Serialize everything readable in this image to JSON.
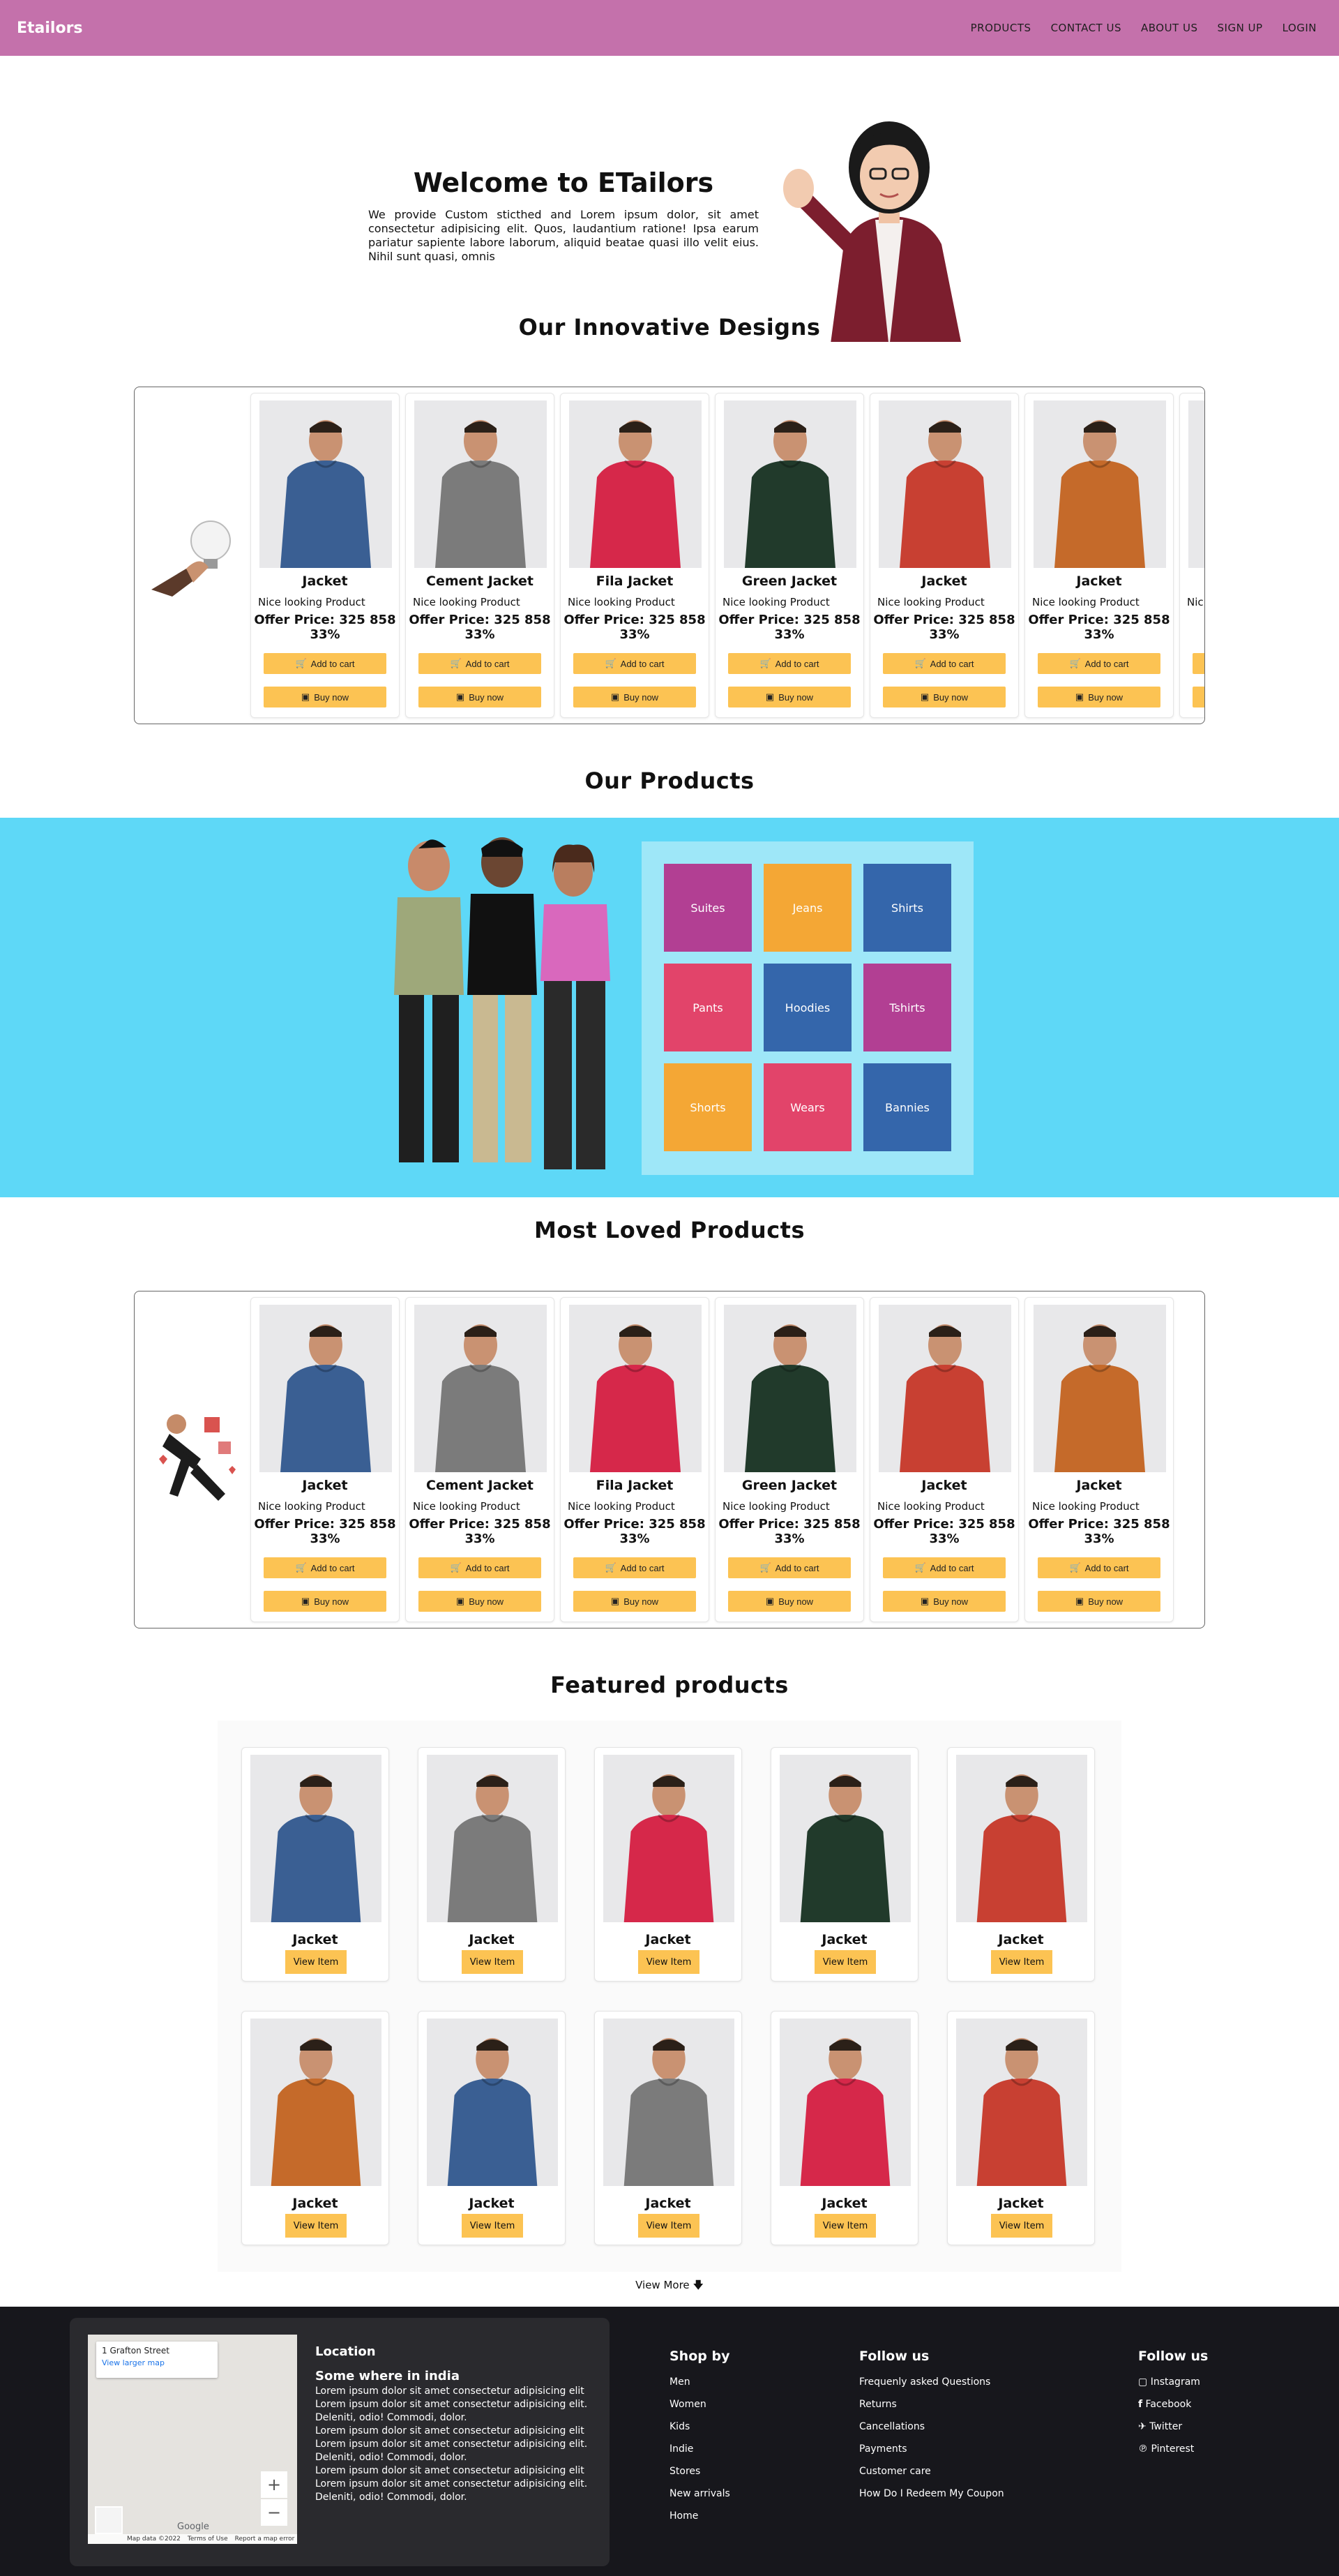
{
  "nav": {
    "brand": "Etailors",
    "links": [
      "PRODUCTS",
      "CONTACT US",
      "ABOUT US",
      "SIGN UP",
      "LOGIN"
    ]
  },
  "hero": {
    "title": "Welcome to ETailors",
    "description": "We provide Custom sticthed and Lorem ipsum dolor, sit amet consectetur adipisicing elit. Quos, laudantium ratione! Ipsa earum pariatur sapiente labore laborum, aliquid beatae quasi illo velit eius. Nihil sunt quasi, omnis"
  },
  "sections": {
    "innovative": "Our Innovative Designs",
    "products": "Our Products",
    "loved": "Most Loved Products",
    "featured": "Featured products"
  },
  "buttons": {
    "add_to_cart": "Add to cart",
    "buy_now": "Buy now",
    "view_item": "View Item",
    "view_more": "View More"
  },
  "innovative_products": [
    {
      "name": "Jacket",
      "sub": "Nice looking Product",
      "price": "Offer Price: 325 858 33%",
      "color": "#3a5f93"
    },
    {
      "name": "Cement Jacket",
      "sub": "Nice looking Product",
      "price": "Offer Price: 325 858 33%",
      "color": "#7b7b7b"
    },
    {
      "name": "Fila Jacket",
      "sub": "Nice looking Product",
      "price": "Offer Price: 325 858 33%",
      "color": "#d6284a"
    },
    {
      "name": "Green Jacket",
      "sub": "Nice looking Product",
      "price": "Offer Price: 325 858 33%",
      "color": "#213a2b"
    },
    {
      "name": "Jacket",
      "sub": "Nice looking Product",
      "price": "Offer Price: 325 858 33%",
      "color": "#c84032"
    },
    {
      "name": "Jacket",
      "sub": "Nice looking Product",
      "price": "Offer Price: 325 858 33%",
      "color": "#c56a2a"
    },
    {
      "name": "Jac",
      "sub": "Nic",
      "price": "Of",
      "color": "#888888"
    }
  ],
  "loved_products": [
    {
      "name": "Jacket",
      "sub": "Nice looking Product",
      "price": "Offer Price: 325 858 33%",
      "color": "#3a5f93"
    },
    {
      "name": "Cement Jacket",
      "sub": "Nice looking Product",
      "price": "Offer Price: 325 858 33%",
      "color": "#7b7b7b"
    },
    {
      "name": "Fila Jacket",
      "sub": "Nice looking Product",
      "price": "Offer Price: 325 858 33%",
      "color": "#d6284a"
    },
    {
      "name": "Green Jacket",
      "sub": "Nice looking Product",
      "price": "Offer Price: 325 858 33%",
      "color": "#213a2b"
    },
    {
      "name": "Jacket",
      "sub": "Nice looking Product",
      "price": "Offer Price: 325 858 33%",
      "color": "#c84032"
    },
    {
      "name": "Jacket",
      "sub": "Nice looking Product",
      "price": "Offer Price: 325 858 33%",
      "color": "#c56a2a"
    }
  ],
  "categories": [
    {
      "label": "Suites",
      "color": "#b23f93"
    },
    {
      "label": "Jeans",
      "color": "#f4a735"
    },
    {
      "label": "Shirts",
      "color": "#3466ab"
    },
    {
      "label": "Pants",
      "color": "#e2446a"
    },
    {
      "label": "Hoodies",
      "color": "#3466ab"
    },
    {
      "label": "Tshirts",
      "color": "#b23f93"
    },
    {
      "label": "Shorts",
      "color": "#f4a735"
    },
    {
      "label": "Wears",
      "color": "#e2446a"
    },
    {
      "label": "Bannies",
      "color": "#3466ab"
    }
  ],
  "featured_products": [
    {
      "name": "Jacket",
      "color": "#3a5f93"
    },
    {
      "name": "Jacket",
      "color": "#7b7b7b"
    },
    {
      "name": "Jacket",
      "color": "#d6284a"
    },
    {
      "name": "Jacket",
      "color": "#213a2b"
    },
    {
      "name": "Jacket",
      "color": "#c84032"
    },
    {
      "name": "Jacket",
      "color": "#c56a2a"
    },
    {
      "name": "Jacket",
      "color": "#3a5f93"
    },
    {
      "name": "Jacket",
      "color": "#7b7b7b"
    },
    {
      "name": "Jacket",
      "color": "#d6284a"
    },
    {
      "name": "Jacket",
      "color": "#c84032"
    }
  ],
  "footer": {
    "map": {
      "address": "1 Grafton Street",
      "link": "View larger map",
      "zoom_in": "+",
      "zoom_out": "−",
      "google": "Google",
      "attrib": [
        "Map data ©2022",
        "Terms of Use",
        "Report a map error"
      ]
    },
    "location": {
      "heading": "Location",
      "subheading": "Some where in india",
      "paragraphs": [
        "Lorem ipsum dolor sit amet consectetur adipisicing elit Lorem ipsum dolor sit amet consectetur adipisicing elit. Deleniti, odio! Commodi, dolor.",
        "Lorem ipsum dolor sit amet consectetur adipisicing elit Lorem ipsum dolor sit amet consectetur adipisicing elit. Deleniti, odio! Commodi, dolor.",
        "Lorem ipsum dolor sit amet consectetur adipisicing elit Lorem ipsum dolor sit amet consectetur adipisicing elit. Deleniti, odio! Commodi, dolor."
      ]
    },
    "shop_by": {
      "heading": "Shop by",
      "items": [
        "Men",
        "Women",
        "Kids",
        "Indie",
        "Stores",
        "New arrivals",
        "Home"
      ]
    },
    "follow_us_1": {
      "heading": "Follow us",
      "items": [
        "Frequenly asked Questions",
        "Returns",
        "Cancellations",
        "Payments",
        "Customer care",
        "How Do I Redeem My Coupon"
      ]
    },
    "follow_us_2": {
      "heading": "Follow us",
      "items": [
        {
          "label": "Instagram",
          "icon": "instagram-icon"
        },
        {
          "label": "Facebook",
          "icon": "facebook-icon"
        },
        {
          "label": "Twitter",
          "icon": "twitter-icon"
        },
        {
          "label": "Pinterest",
          "icon": "pinterest-icon"
        }
      ]
    }
  }
}
